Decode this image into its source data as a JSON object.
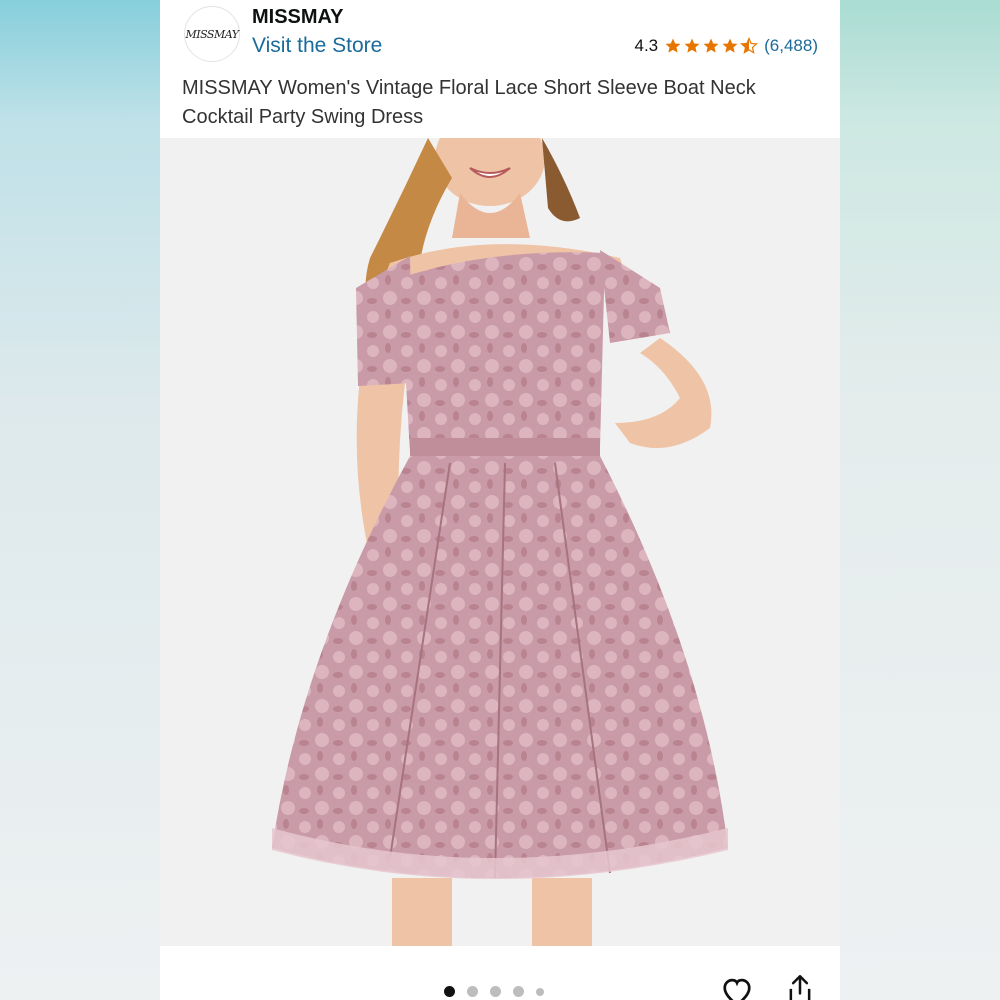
{
  "store": {
    "logo_text": "MISSMAY",
    "brand": "MISSMAY",
    "visit_link": "Visit the Store"
  },
  "rating": {
    "value": "4.3",
    "count": "(6,488)",
    "stars_fraction": 0.86,
    "star_color": "#e77600"
  },
  "product": {
    "title": "MISSMAY Women's Vintage Floral Lace Short Sleeve Boat Neck Cocktail Party Swing Dress"
  },
  "gallery": {
    "image_count": 5,
    "active_index": 0
  },
  "actions": {
    "wishlist_icon": "heart-icon",
    "share_icon": "share-icon"
  },
  "colors": {
    "link": "#1a6b9a",
    "dress": "#c99aa7",
    "hair": "#c48a45"
  }
}
